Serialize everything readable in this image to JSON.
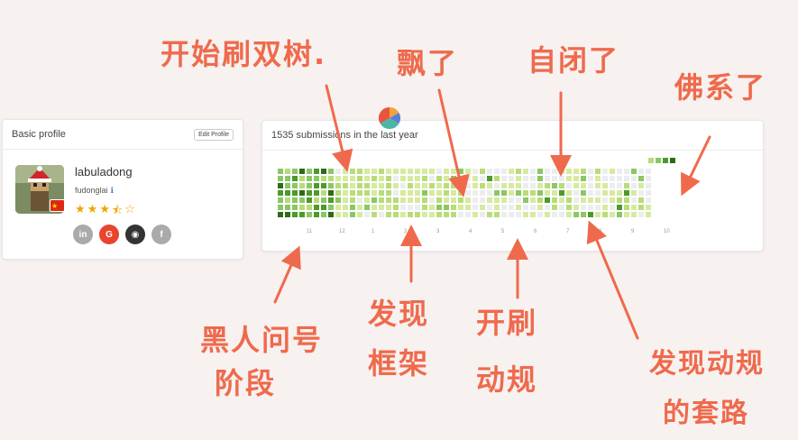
{
  "profile": {
    "header": "Basic profile",
    "edit_label": "Edit Profile",
    "username": "labuladong",
    "realname": "fudonglai",
    "info_icon": "ℹ",
    "rating": 3.5,
    "stars": [
      "★",
      "★",
      "★",
      "⯪",
      "☆"
    ],
    "social": [
      {
        "name": "linkedin-icon",
        "glyph": "in"
      },
      {
        "name": "google-icon",
        "glyph": "G"
      },
      {
        "name": "github-icon",
        "glyph": "◉"
      },
      {
        "name": "facebook-icon",
        "glyph": "f"
      }
    ]
  },
  "heatmap": {
    "title": "1535 submissions in the last year",
    "months": [
      "11",
      "12",
      "1",
      "2",
      "3",
      "4",
      "5",
      "6",
      "7",
      "8",
      "9",
      "10"
    ],
    "weeks": 52,
    "seed": 7,
    "colors": [
      "#ebedf0",
      "#d6eaa0",
      "#b8dc78",
      "#8cc665",
      "#4c9a2a",
      "#2d6b1a"
    ]
  },
  "annotations": {
    "a1": "开始刷双树.",
    "a2": "飘了",
    "a3": "自闭了",
    "a4": "佛系了",
    "a5_line1": "黑人问号",
    "a5_line2": "阶段",
    "a6_line1": "发现",
    "a6_line2": "框架",
    "a7_line1": "开刷",
    "a7_line2": "动规",
    "a8_line1": "发现动规",
    "a8_line2": "的套路"
  }
}
